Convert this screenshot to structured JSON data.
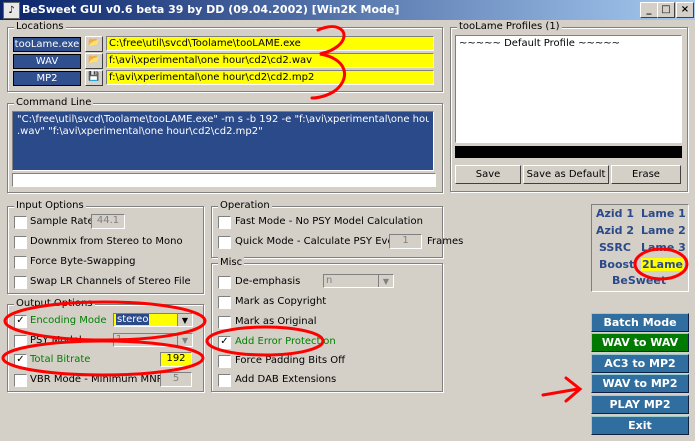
{
  "window": {
    "title": "BeSweet GUI v0.6 beta 39 by DD (09.04.2002)   [Win2K Mode]",
    "min": "_",
    "max": "□",
    "close": "×"
  },
  "locations": {
    "label": "Locations",
    "rows": [
      {
        "button": "tooLame.exe",
        "path": "C:\\free\\util\\svcd\\Toolame\\tooLAME.exe"
      },
      {
        "button": "WAV",
        "path": "f:\\avi\\xperimental\\one hour\\cd2\\cd2.wav"
      },
      {
        "button": "MP2",
        "path": "f:\\avi\\xperimental\\one hour\\cd2\\cd2.mp2"
      }
    ]
  },
  "profiles": {
    "label": "tooLame Profiles (1)",
    "items": [
      "~~~~~ Default Profile ~~~~~"
    ],
    "save": "Save",
    "save_default": "Save as Default",
    "erase": "Erase"
  },
  "command": {
    "label": "Command Line",
    "lines": [
      "\"C:\\free\\util\\svcd\\Toolame\\tooLAME.exe\" -m s -b 192 -e \"f:\\avi\\xperimental\\one hour\\cd2\\cd2",
      ".wav\" \"f:\\avi\\xperimental\\one hour\\cd2\\cd2.mp2\""
    ]
  },
  "input_options": {
    "label": "Input Options",
    "sample_rate": "Sample Rate",
    "sample_rate_value": "44.1",
    "downmix": "Downmix from Stereo to Mono",
    "force_byte": "Force Byte-Swapping",
    "swap_lr": "Swap LR Channels of Stereo File"
  },
  "output_options": {
    "label": "Output Options",
    "encoding_mode": "Encoding Mode",
    "encoding_mode_value": "stereo",
    "psy_model": "PSY Model",
    "psy_model_value": "1",
    "total_bitrate": "Total Bitrate",
    "total_bitrate_value": "192",
    "vbr_mode": "VBR Mode - Minimum MNR =",
    "vbr_value": "5"
  },
  "operation": {
    "label": "Operation",
    "fast_mode": "Fast Mode - No PSY Model Calculation",
    "quick_mode": "Quick Mode - Calculate PSY Every",
    "quick_value": "1",
    "frames": "Frames"
  },
  "misc": {
    "label": "Misc",
    "de_emphasis": "De-emphasis",
    "de_emphasis_value": "n",
    "copyright": "Mark as Copyright",
    "original": "Mark as Original",
    "error_protection": "Add Error Protection",
    "padding": "Force Padding Bits Off",
    "dab": "Add DAB Extensions"
  },
  "nav": {
    "azid1": "Azid 1",
    "lame1": "Lame 1",
    "azid2": "Azid 2",
    "lame2": "Lame 2",
    "ssrc": "SSRC",
    "lame3": "Lame 3",
    "boost": "Boost",
    "2lame": "2Lame",
    "besweet": "BeSweet"
  },
  "actions": {
    "batch": "Batch Mode",
    "wav_wav": "WAV to WAV",
    "ac3_mp2": "AC3 to MP2",
    "wav_mp2": "WAV to MP2",
    "play": "PLAY MP2",
    "exit": "Exit"
  },
  "colors": {
    "accent": "#2f4f8f",
    "highlight": "#ffff00",
    "annotation": "#ff0000"
  }
}
